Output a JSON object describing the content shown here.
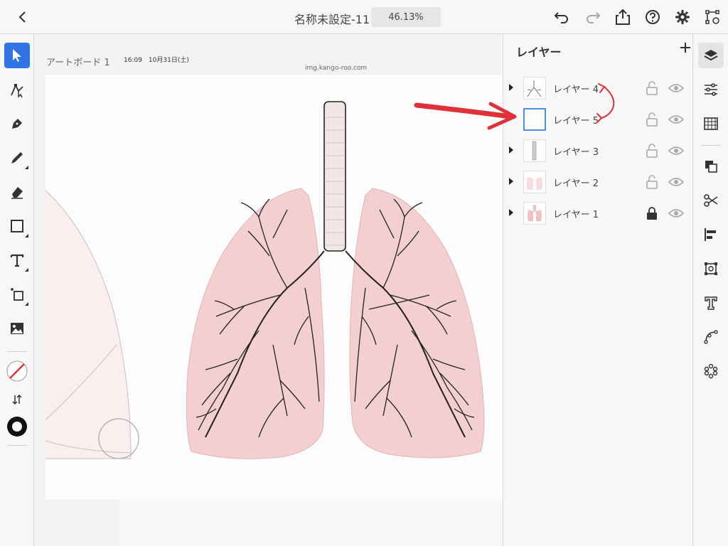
{
  "header": {
    "title": "名称未設定-11",
    "zoom": "46.13%"
  },
  "canvas": {
    "artboard_label": "アートボード 1",
    "photo_time": "16:09　10月31日(土)",
    "photo_url": "img.kango-roo.com"
  },
  "layers_panel": {
    "title": "レイヤー",
    "layers": [
      {
        "name": "レイヤー 4",
        "locked": false,
        "selected": false
      },
      {
        "name": "レイヤー 5",
        "locked": false,
        "selected": true
      },
      {
        "name": "レイヤー 3",
        "locked": false,
        "selected": false
      },
      {
        "name": "レイヤー 2",
        "locked": false,
        "selected": false
      },
      {
        "name": "レイヤー 1",
        "locked": true,
        "selected": false
      }
    ]
  },
  "colors": {
    "accent": "#2f76e4",
    "annotation_red": "#e0303a",
    "lung_pink": "#f3cfcf"
  }
}
